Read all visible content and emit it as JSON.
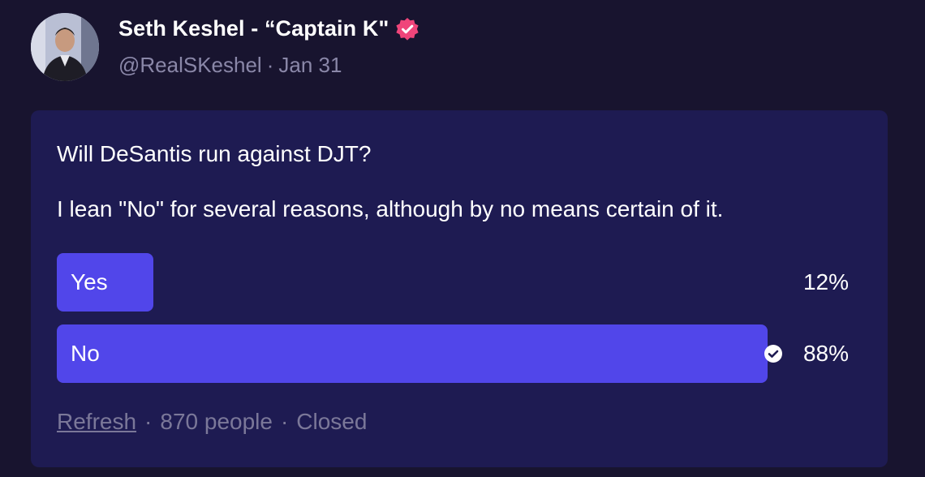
{
  "author": {
    "display_name": "Seth Keshel - “Captain K\"",
    "handle": "@RealSKeshel",
    "separator": "·",
    "date": "Jan 31",
    "verified_icon": "verified-badge-icon",
    "verified_color": "#f0457a"
  },
  "post": {
    "line1": "Will DeSantis run against DJT?",
    "line2": "I lean \"No\" for several reasons, although by no means certain of it."
  },
  "poll": {
    "bar_color": "#5146ea",
    "options": [
      {
        "label": "Yes",
        "percent_text": "12%",
        "percent": 12,
        "selected": false
      },
      {
        "label": "No",
        "percent_text": "88%",
        "percent": 88,
        "selected": true
      }
    ],
    "selected_icon": "check-circle-icon",
    "footer": {
      "refresh_label": "Refresh",
      "separator": "·",
      "voters": "870 people",
      "status": "Closed"
    }
  }
}
